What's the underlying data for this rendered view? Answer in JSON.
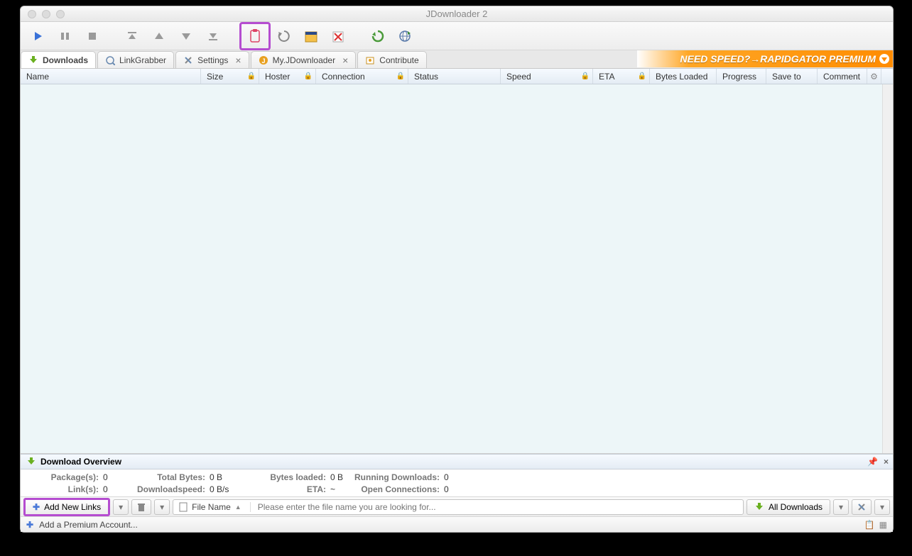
{
  "window": {
    "title": "JDownloader 2"
  },
  "tabs": {
    "downloads": "Downloads",
    "linkgrabber": "LinkGrabber",
    "settings": "Settings",
    "myjdownloader": "My.JDownloader",
    "contribute": "Contribute"
  },
  "banner": "NEED SPEED?→RAPIDGATOR PREMIUM",
  "columns": {
    "name": "Name",
    "size": "Size",
    "hoster": "Hoster",
    "connection": "Connection",
    "status": "Status",
    "speed": "Speed",
    "eta": "ETA",
    "bytes_loaded": "Bytes Loaded",
    "progress": "Progress",
    "save_to": "Save to",
    "comment": "Comment"
  },
  "overview": {
    "title": "Download Overview",
    "packages_label": "Package(s):",
    "packages": "0",
    "links_label": "Link(s):",
    "links": "0",
    "total_bytes_label": "Total Bytes:",
    "total_bytes": "0 B",
    "downloadspeed_label": "Downloadspeed:",
    "downloadspeed": "0 B/s",
    "bytes_loaded_label": "Bytes loaded:",
    "bytes_loaded": "0 B",
    "eta_label": "ETA:",
    "eta": "~",
    "running_label": "Running Downloads:",
    "running": "0",
    "open_conn_label": "Open Connections:",
    "open_conn": "0"
  },
  "bottom": {
    "add_new_links": "Add New Links",
    "file_name": "File Name",
    "search_placeholder": "Please enter the file name you are looking for...",
    "all_downloads": "All Downloads"
  },
  "status": {
    "add_premium": "Add a Premium Account..."
  }
}
